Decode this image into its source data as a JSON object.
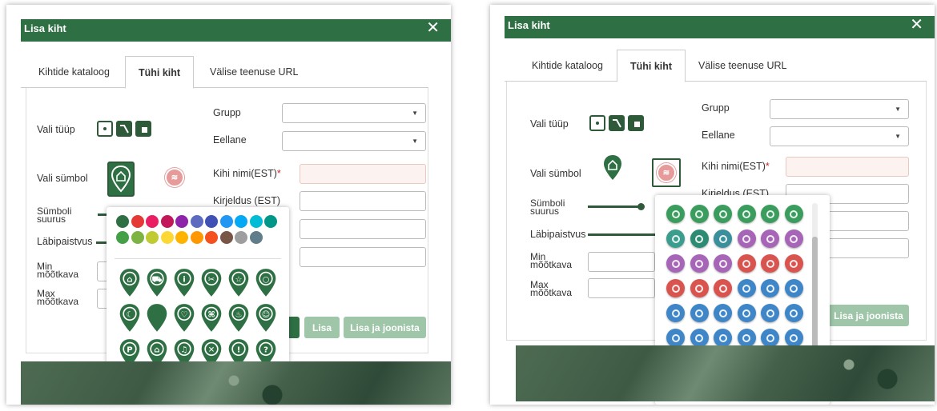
{
  "dialog": {
    "title": "Lisa kiht",
    "close_glyph": "✕",
    "tabs": [
      "Kihtide kataloog",
      "Tühi kiht",
      "Välise teenuse URL"
    ]
  },
  "form": {
    "type_label": "Vali tüüp",
    "symbol_label": "Vali sümbol",
    "size_label_1": "Sümboli",
    "size_label_2": "suurus",
    "opacity_label": "Läbipaistvus",
    "min_scale_1": "Min",
    "min_scale_2": "mõõtkava",
    "max_scale_1": "Max",
    "max_scale_2": "mõõtkava",
    "group_label": "Grupp",
    "parent_label": "Eellane",
    "name_label": "Kihi nimi(EST)",
    "required_mark": "*",
    "desc_label": "Kirjeldus (EST)"
  },
  "buttons": {
    "add": "Lisa",
    "add_and_draw": "Lisa ja joonista"
  },
  "symbol_preview": {
    "pink_text": "≋"
  },
  "colors": {
    "accent": "#2e7044",
    "dark_green": "#2e5a3a",
    "button_green": "#9fc6a9",
    "required_bg": "#fcf2ef",
    "palette_row1": [
      "#2e7044",
      "#e53935",
      "#e91e63",
      "#c2185b",
      "#8e24aa",
      "#5c6bc0",
      "#3f51b5",
      "#2196f3",
      "#03a9f4",
      "#00bcd4",
      "#009688"
    ],
    "palette_row2": [
      "#43a047",
      "#7cb342",
      "#c0ca33",
      "#fdd835",
      "#ffb300",
      "#ff9800",
      "#f4511e",
      "#795548",
      "#9e9e9e",
      "#607d8b"
    ]
  },
  "icon_grid_left": [
    [
      "home-icon",
      "cart-icon",
      "info-icon",
      "tools-icon",
      "star-icon",
      "circle-icon"
    ],
    [
      "moon-icon",
      "blank-icon",
      "heart-icon",
      "command-icon",
      "cup-icon",
      "smiley-icon"
    ],
    [
      "parking-icon",
      "bank-icon",
      "music-icon",
      "x-icon",
      "exclamation-icon",
      "question-icon"
    ],
    [
      "check-icon",
      "asterisk-icon",
      "plus-icon",
      "graduation-icon",
      "swim-icon",
      "run-icon"
    ]
  ],
  "icon_grid_right_colors": [
    [
      "#3a9d5d",
      "#3a9d5d",
      "#3a9d5d",
      "#3a9d5d",
      "#3a9d5d",
      "#3a9d5d"
    ],
    [
      "#3a9d8e",
      "#2e8b73",
      "#3a8f9d",
      "#a665b7",
      "#a665b7",
      "#a665b7"
    ],
    [
      "#a665b7",
      "#a665b7",
      "#a665b7",
      "#d9534f",
      "#d9534f",
      "#d9534f"
    ],
    [
      "#d9534f",
      "#d9534f",
      "#d9534f",
      "#3f86c9",
      "#3f86c9",
      "#3f86c9"
    ],
    [
      "#3f86c9",
      "#3f86c9",
      "#3f86c9",
      "#3f86c9",
      "#3f86c9",
      "#3f86c9"
    ],
    [
      "#3f86c9",
      "#3f86c9",
      "#3f86c9",
      "#3f86c9",
      "#3f86c9",
      "#3f86c9"
    ],
    [
      "#3f86c9",
      "#e98b2e",
      "#e98b2e",
      "#e98b2e",
      "#e98b2e",
      "#e98b2e"
    ],
    [
      "#f0a62d",
      "#f0a62d",
      "#f0a62d",
      "#f0a62d",
      "#f0a62d",
      "#f0a62d"
    ]
  ]
}
